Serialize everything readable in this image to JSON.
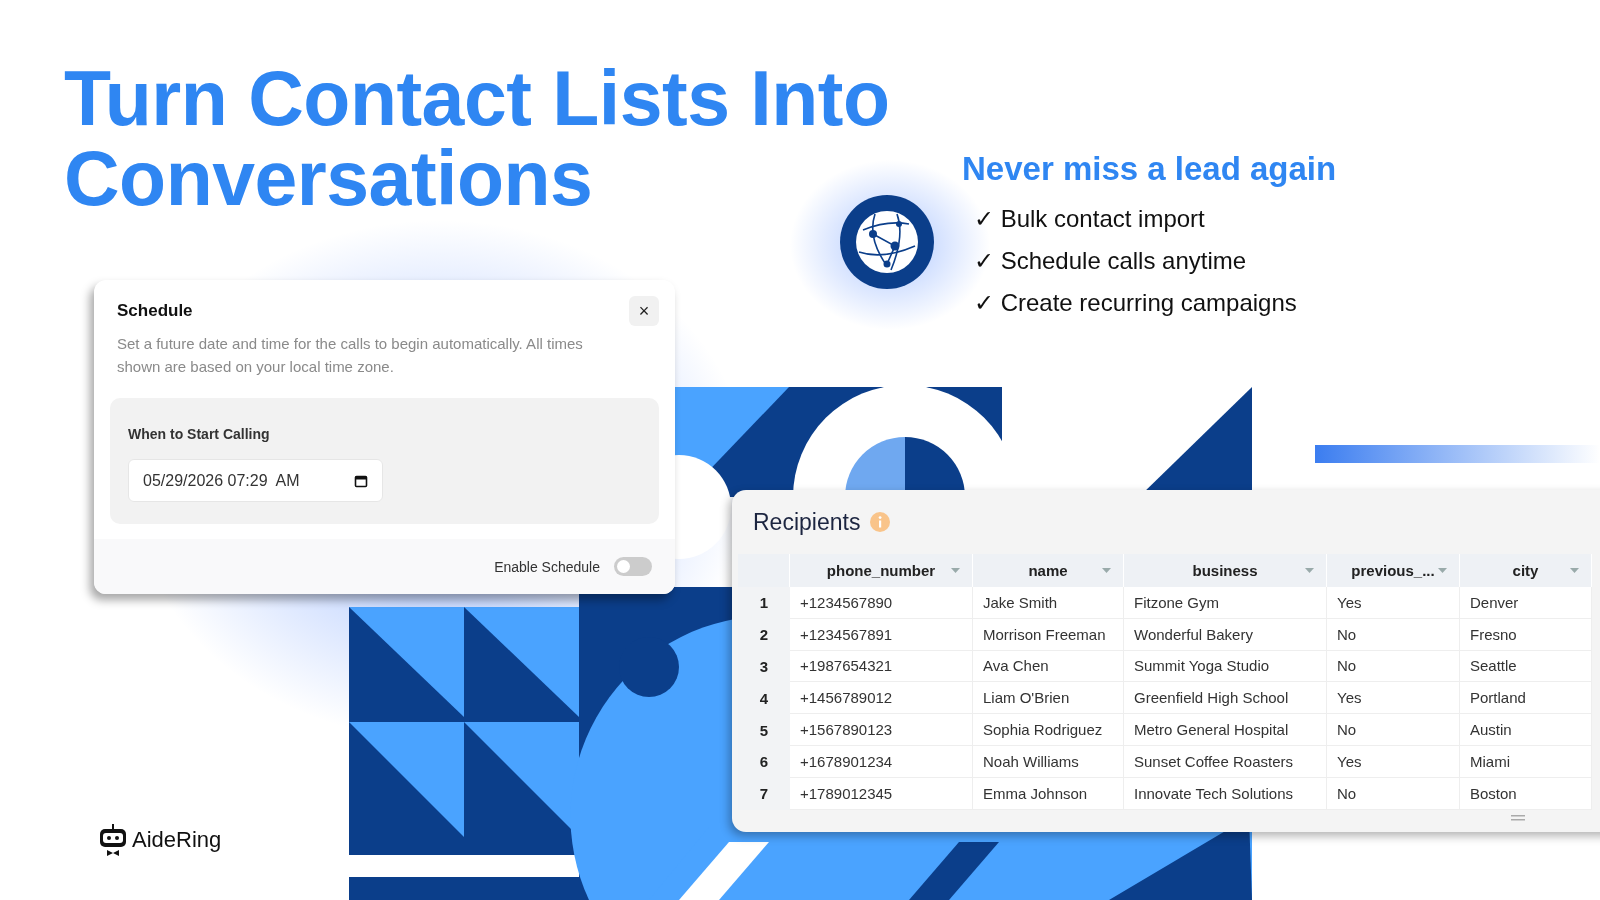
{
  "headline": "Turn Contact Lists Into Conversations",
  "features": {
    "title": "Never miss a lead again",
    "items": [
      "✓ Bulk contact import",
      "✓ Schedule calls anytime",
      "✓ Create recurring campaigns"
    ]
  },
  "schedule_dialog": {
    "title": "Schedule",
    "close": "×",
    "description": "Set a future date and time for the calls to begin automatically. All times shown are based on your local time zone.",
    "field_label": "When to Start Calling",
    "date_value": "05/29/2026 07:29  AM",
    "toggle": {
      "label": "Enable Schedule",
      "on": false
    }
  },
  "recipients": {
    "title": "Recipients",
    "columns": [
      "phone_number",
      "name",
      "business",
      "previous_...",
      "city"
    ],
    "rows": [
      {
        "index": "1",
        "cells": [
          "+1234567890",
          "Jake Smith",
          "Fitzone Gym",
          "Yes",
          "Denver"
        ]
      },
      {
        "index": "2",
        "cells": [
          "+1234567891",
          "Morrison Freeman",
          "Wonderful Bakery",
          "No",
          "Fresno"
        ]
      },
      {
        "index": "3",
        "cells": [
          "+1987654321",
          "Ava Chen",
          "Summit Yoga Studio",
          "No",
          "Seattle"
        ]
      },
      {
        "index": "4",
        "cells": [
          "+1456789012",
          "Liam O'Brien",
          "Greenfield High School",
          "Yes",
          "Portland"
        ]
      },
      {
        "index": "5",
        "cells": [
          "+1567890123",
          "Sophia Rodriguez",
          "Metro General Hospital",
          "No",
          "Austin"
        ]
      },
      {
        "index": "6",
        "cells": [
          "+1678901234",
          "Noah Williams",
          "Sunset Coffee Roasters",
          "Yes",
          "Miami"
        ]
      },
      {
        "index": "7",
        "cells": [
          "+1789012345",
          "Emma Johnson",
          "Innovate Tech Solutions",
          "No",
          "Boston"
        ]
      }
    ]
  },
  "logo": {
    "name": "AideRing"
  }
}
